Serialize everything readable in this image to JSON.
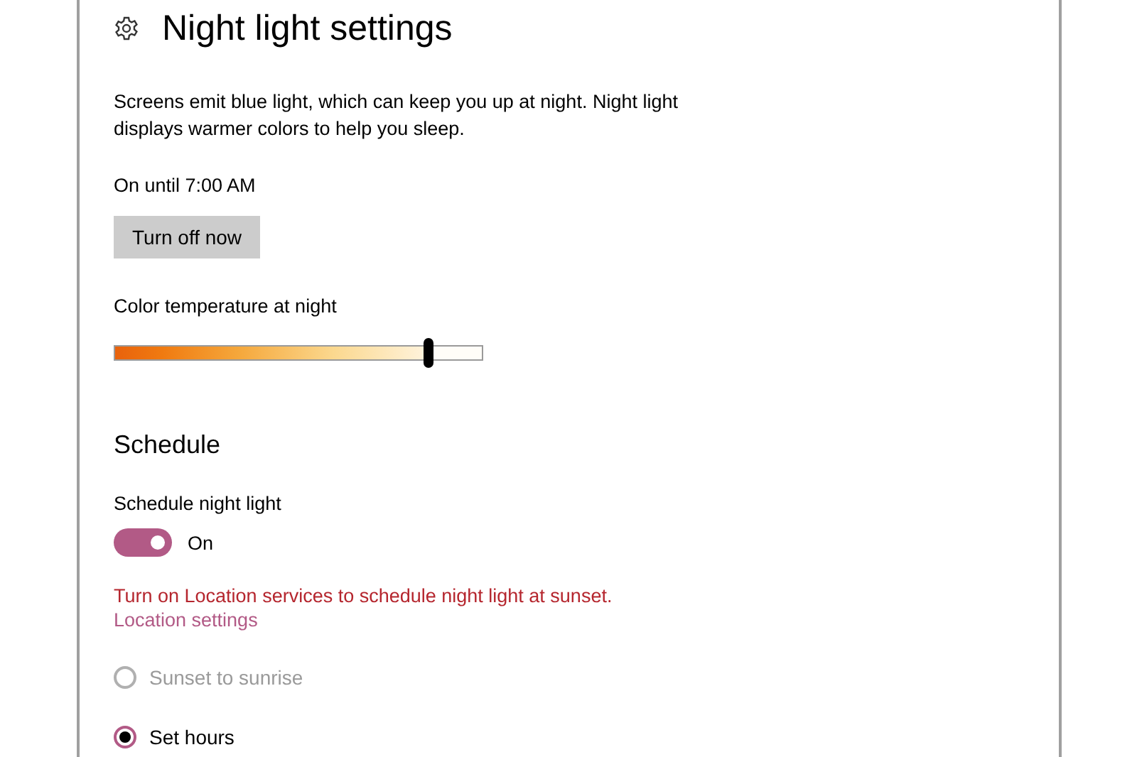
{
  "page": {
    "title": "Night light settings"
  },
  "description": "Screens emit blue light, which can keep you up at night. Night light displays warmer colors to help you sleep.",
  "status": "On until 7:00 AM",
  "turn_off_button": "Turn off now",
  "color_temperature": {
    "label": "Color temperature at night",
    "level": 0.85
  },
  "schedule": {
    "heading": "Schedule",
    "toggle": {
      "label": "Schedule night light",
      "on": true,
      "state_text": "On"
    },
    "warning": "Turn on Location services to schedule night light at sunset.",
    "link": "Location settings",
    "options": [
      {
        "label": "Sunset to sunrise",
        "selected": false,
        "disabled": true
      },
      {
        "label": "Set hours",
        "selected": true,
        "disabled": false
      }
    ]
  }
}
